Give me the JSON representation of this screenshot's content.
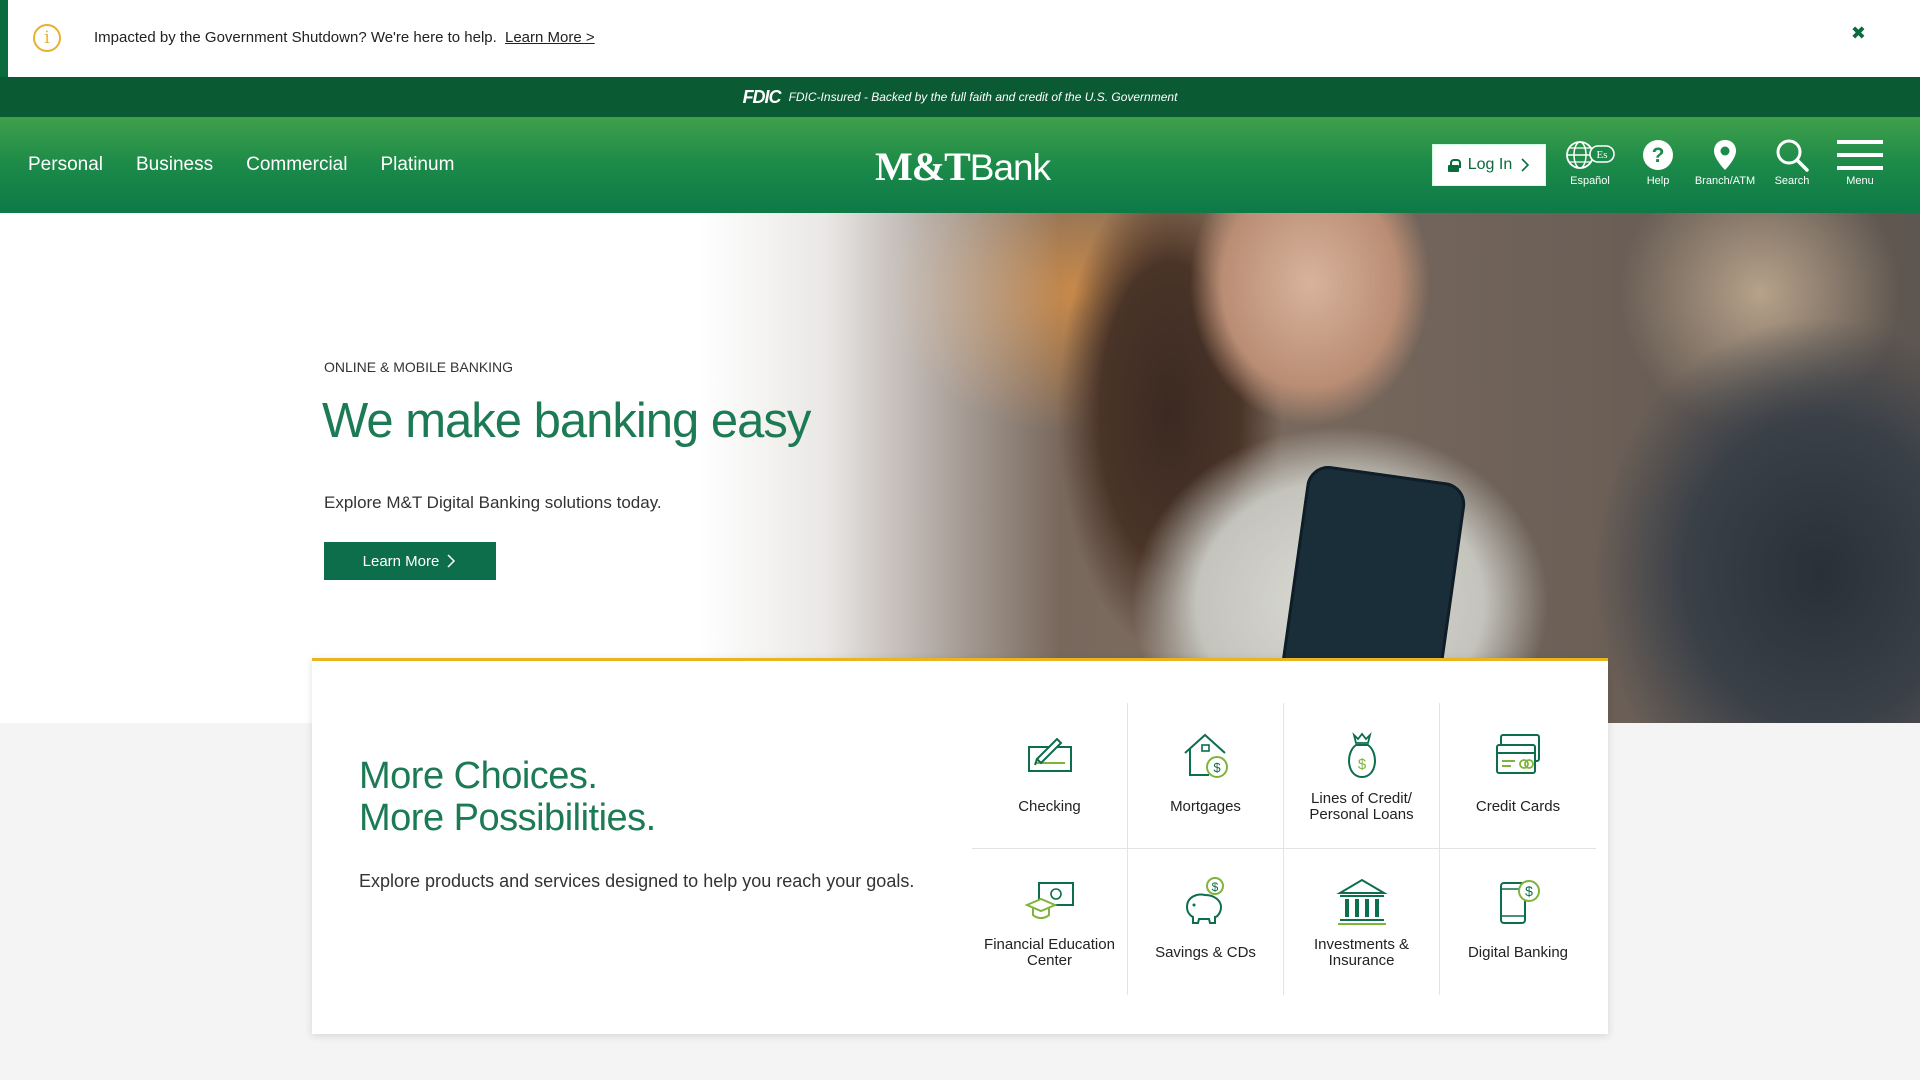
{
  "alert": {
    "message": "Impacted by the Government Shutdown? We're here to help.",
    "link": "Learn More >",
    "close": "✖"
  },
  "fdic": {
    "logo": "FDIC",
    "text": "FDIC-Insured - Backed by the full faith and credit of the U.S. Government"
  },
  "header": {
    "nav": [
      "Personal",
      "Business",
      "Commercial",
      "Platinum"
    ],
    "brand_mt": "M&T",
    "brand_bank": "Bank",
    "login": "Log In",
    "utilities": [
      {
        "label": "Español",
        "icon": "globe-icon",
        "badge": "Es"
      },
      {
        "label": "Help",
        "icon": "help-icon"
      },
      {
        "label": "Branch/ATM",
        "icon": "location-pin-icon"
      },
      {
        "label": "Search",
        "icon": "search-icon"
      },
      {
        "label": "Menu",
        "icon": "hamburger-menu-icon"
      }
    ]
  },
  "hero": {
    "eyebrow": "ONLINE & MOBILE BANKING",
    "title": "We make banking easy",
    "subtitle": "Explore M&T Digital Banking solutions today.",
    "cta": "Learn More"
  },
  "choices": {
    "title_line1": "More Choices.",
    "title_line2": "More Possibilities.",
    "description": "Explore products and services designed to help you reach your goals.",
    "items": [
      {
        "label": "Checking",
        "icon": "checkbook-icon"
      },
      {
        "label": "Mortgages",
        "icon": "house-dollar-icon"
      },
      {
        "label": "Lines of Credit/ Personal Loans",
        "icon": "money-bag-icon"
      },
      {
        "label": "Credit Cards",
        "icon": "credit-card-icon"
      },
      {
        "label": "Financial Education Center",
        "icon": "graduation-cap-icon"
      },
      {
        "label": "Savings & CDs",
        "icon": "piggy-bank-icon"
      },
      {
        "label": "Investments & Insurance",
        "icon": "bank-building-icon"
      },
      {
        "label": "Digital Banking",
        "icon": "mobile-dollar-icon"
      }
    ]
  },
  "colors": {
    "brand_green": "#0a6b3d",
    "accent_green": "#1c7a55",
    "gold": "#e8b521"
  }
}
